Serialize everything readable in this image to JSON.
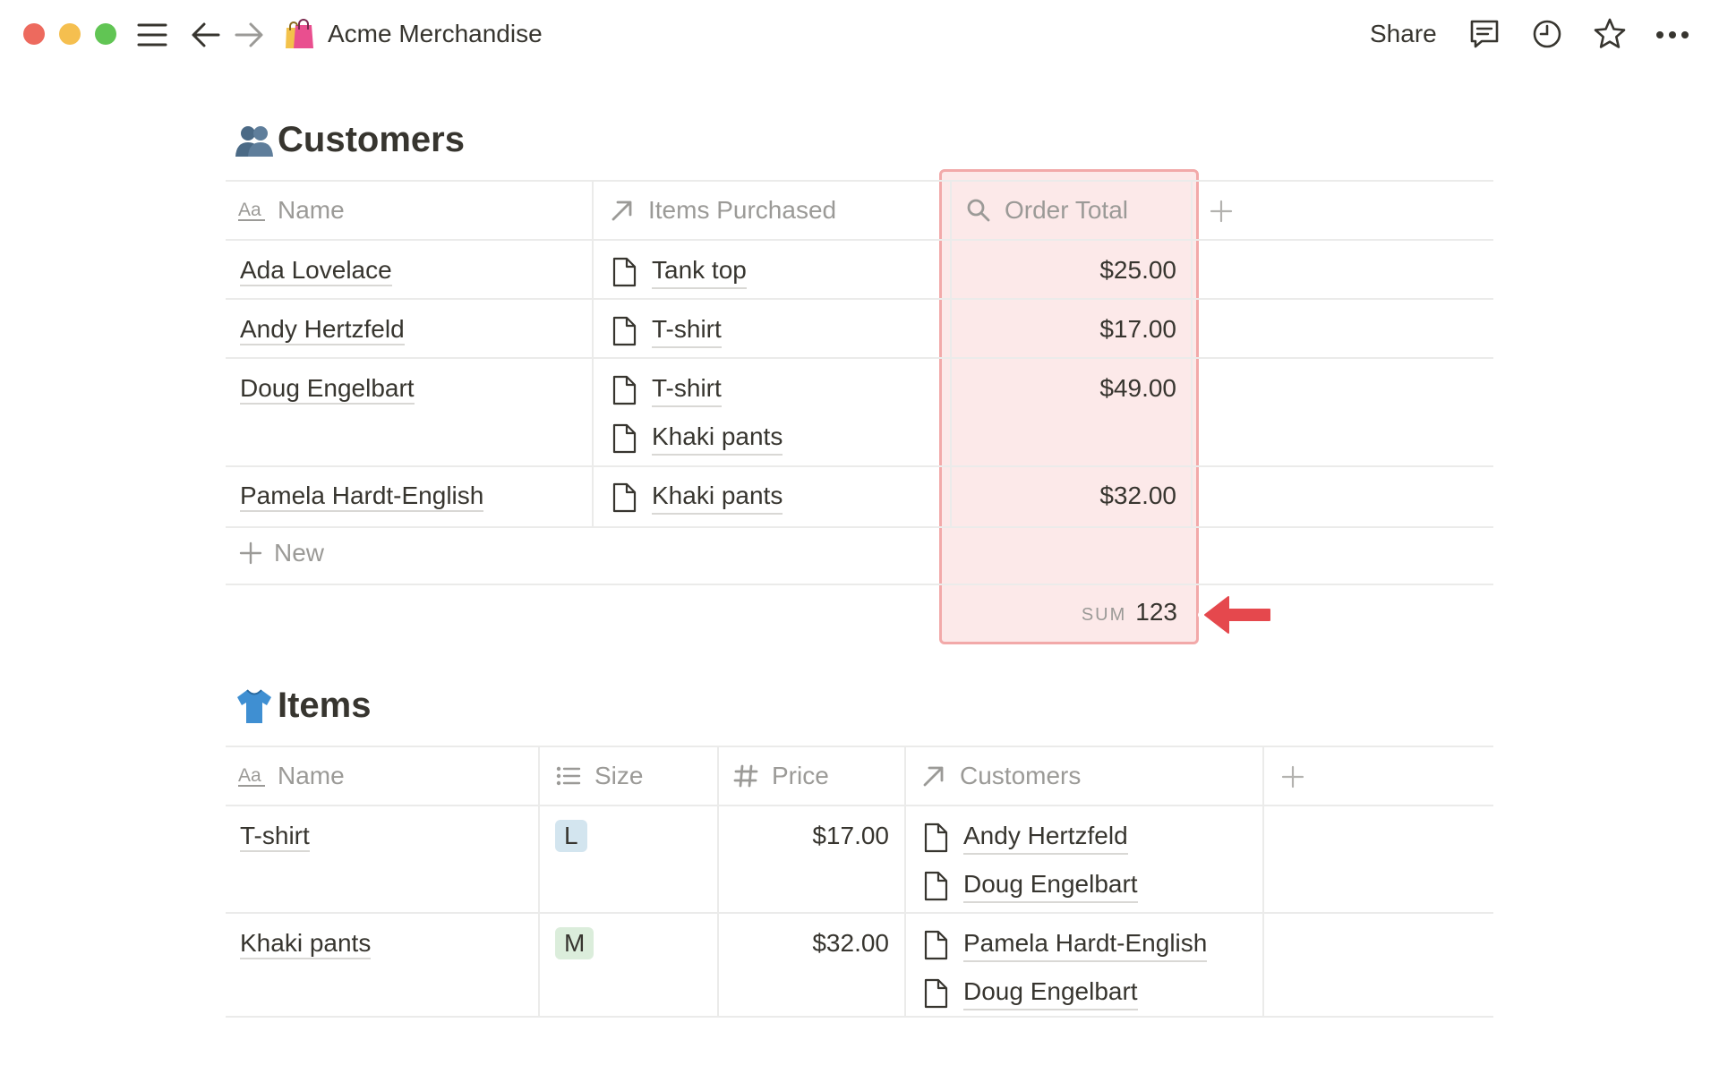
{
  "window": {
    "title": "Acme Merchandise",
    "share_label": "Share"
  },
  "customers": {
    "title": "Customers",
    "columns": {
      "name": "Name",
      "items_purchased": "Items Purchased",
      "order_total": "Order Total"
    },
    "rows": [
      {
        "name": "Ada Lovelace",
        "items": [
          "Tank top"
        ],
        "total": "$25.00"
      },
      {
        "name": "Andy Hertzfeld",
        "items": [
          "T-shirt"
        ],
        "total": "$17.00"
      },
      {
        "name": "Doug Engelbart",
        "items": [
          "T-shirt",
          "Khaki pants"
        ],
        "total": "$49.00"
      },
      {
        "name": "Pamela Hardt-English",
        "items": [
          "Khaki pants"
        ],
        "total": "$32.00"
      }
    ],
    "new_label": "New",
    "sum_label": "SUM",
    "sum_value": "123"
  },
  "items": {
    "title": "Items",
    "columns": {
      "name": "Name",
      "size": "Size",
      "price": "Price",
      "customers": "Customers"
    },
    "rows": [
      {
        "name": "T-shirt",
        "size": "L",
        "price": "$17.00",
        "customers": [
          "Andy Hertzfeld",
          "Doug Engelbart"
        ]
      },
      {
        "name": "Khaki pants",
        "size": "M",
        "price": "$32.00",
        "customers": [
          "Pamela Hardt-English",
          "Doug Engelbart"
        ]
      }
    ]
  },
  "colors": {
    "highlight_border": "#f2a9a9",
    "arrow": "#e5484d",
    "tag_l_bg": "#d3e5ef",
    "tag_m_bg": "#dbeddb",
    "traffic_red": "#ed6a5e",
    "traffic_yellow": "#f5bf4f",
    "traffic_green": "#61c554"
  },
  "icons": {
    "menu": "hamburger-icon",
    "back": "arrow-left-icon",
    "forward": "arrow-right-icon",
    "page": "shopping-bags-icon",
    "comments": "comment-icon",
    "updates": "clock-icon",
    "favorite": "star-icon",
    "more": "ellipsis-icon"
  }
}
